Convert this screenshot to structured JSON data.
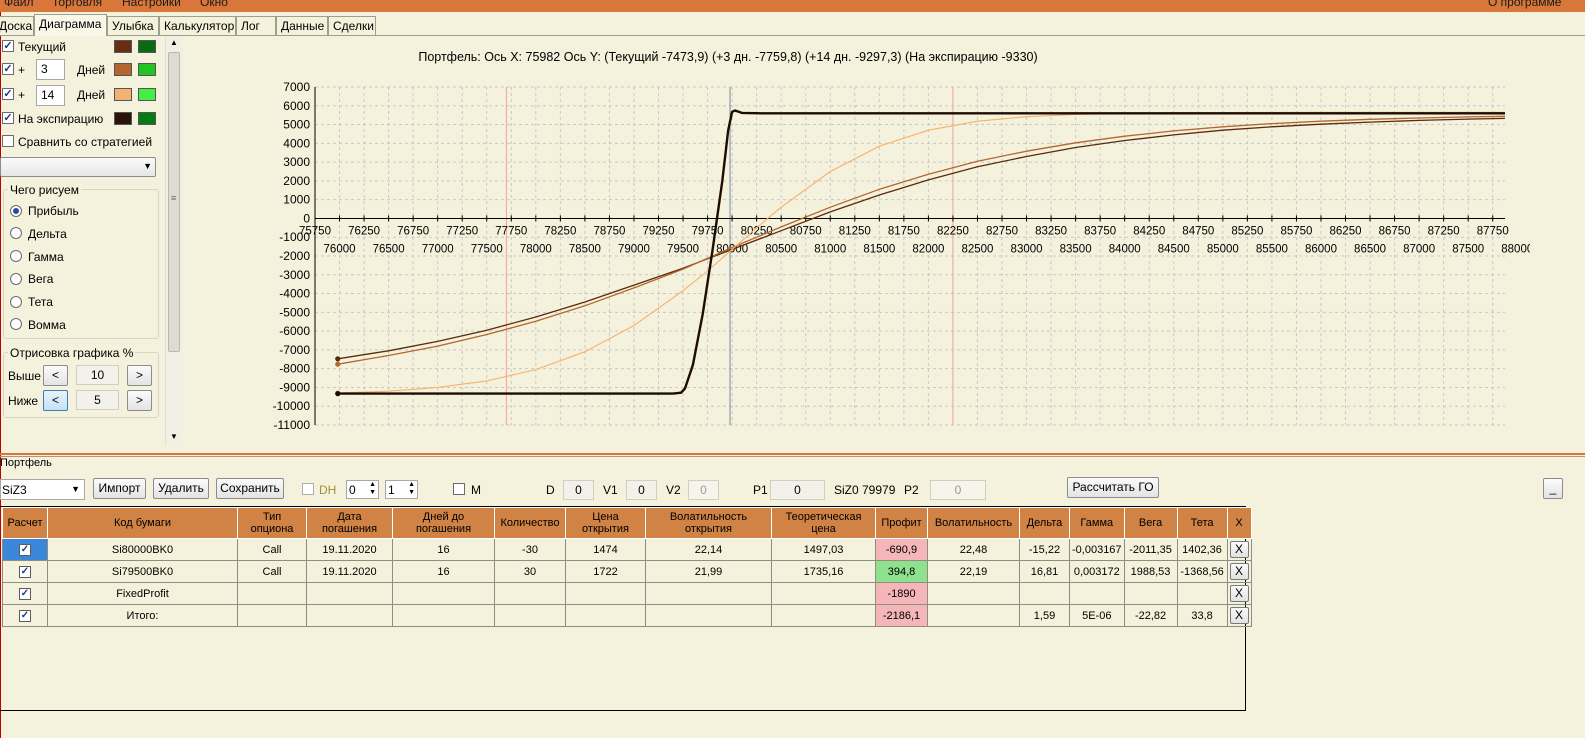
{
  "menu": {
    "items": [
      "Файл",
      "Торговля",
      "Настройки",
      "Окно"
    ],
    "about": "О программе"
  },
  "tabs": [
    "Доска",
    "Диаграмма",
    "Улыбка",
    "Калькулятор",
    "Лог",
    "Данные",
    "Сделки"
  ],
  "left_panel": {
    "current_label": "Текущий",
    "plus": "+",
    "days_label": "Дней",
    "days_1": "3",
    "days_2": "14",
    "expiry_label": "На экспирацию",
    "compare_label": "Сравнить со стратегией",
    "draw_group": "Чего рисуем",
    "options": [
      "Прибыль",
      "Дельта",
      "Гамма",
      "Вега",
      "Тета",
      "Вомма"
    ],
    "render_group": "Отрисовка графика %",
    "above_label": "Выше",
    "below_label": "Ниже",
    "above_value": "10",
    "below_value": "5",
    "prev": "<",
    "next": ">",
    "colors": {
      "current": [
        "#6b2d12",
        "#0b6b12"
      ],
      "d3": [
        "#b5652e",
        "#22c422"
      ],
      "d14": [
        "#f3b273",
        "#44ee44"
      ],
      "expiry": [
        "#2a1407",
        "#077a12"
      ]
    }
  },
  "chart_data": {
    "type": "line",
    "title": "Портфель: Ось X: 75982 Ось Y:  (Текущий -7473,9)  (+3 дн. -7759,8)  (+14 дн. -9297,3)  (На экспирацию -9330)",
    "xlim": [
      75750,
      87875
    ],
    "ylim": [
      -11000,
      7000
    ],
    "x_ticks_top": [
      75750,
      76250,
      76750,
      77250,
      77750,
      78250,
      78750,
      79250,
      79750,
      80250,
      80750,
      81250,
      81750,
      82250,
      82750,
      83250,
      83750,
      84250,
      84750,
      85250,
      85750,
      86250,
      86750,
      87250,
      87750
    ],
    "x_ticks_bottom": [
      76000,
      76500,
      77000,
      77500,
      78000,
      78500,
      79000,
      79500,
      80000,
      80500,
      81000,
      81500,
      82000,
      82500,
      83000,
      83500,
      84000,
      84500,
      85000,
      85500,
      86000,
      86500,
      87000,
      87500,
      88000
    ],
    "y_ticks": [
      7000,
      6000,
      5000,
      4000,
      3000,
      2000,
      1000,
      0,
      -1000,
      -2000,
      -3000,
      -4000,
      -5000,
      -6000,
      -7000,
      -8000,
      -9000,
      -10000,
      -11000
    ],
    "grid": true,
    "vlines": [
      {
        "x": 77700,
        "color": "#f2a0a0"
      },
      {
        "x": 79979,
        "color": "#7a8ca8"
      },
      {
        "x": 82250,
        "color": "#f2a0a0"
      }
    ],
    "series": [
      {
        "name": "Текущий",
        "color": "#5a2a0c",
        "width": 1.3,
        "x": [
          75982,
          76500,
          77000,
          77500,
          78000,
          78500,
          79000,
          79500,
          80000,
          80500,
          81000,
          81500,
          82000,
          82500,
          83000,
          83500,
          84000,
          84500,
          85000,
          85500,
          86000,
          86500,
          87000,
          87500,
          87875
        ],
        "y": [
          -7474,
          -7050,
          -6550,
          -5950,
          -5250,
          -4450,
          -3550,
          -2650,
          -1650,
          -650,
          350,
          1250,
          2050,
          2750,
          3300,
          3780,
          4150,
          4450,
          4700,
          4880,
          5020,
          5130,
          5220,
          5290,
          5330
        ]
      },
      {
        "name": "+3 дн.",
        "color": "#b5652e",
        "width": 1.3,
        "x": [
          75982,
          76500,
          77000,
          77500,
          78000,
          78500,
          79000,
          79500,
          80000,
          80500,
          81000,
          81500,
          82000,
          82500,
          83000,
          83500,
          84000,
          84500,
          85000,
          85500,
          86000,
          86500,
          87000,
          87500,
          87875
        ],
        "y": [
          -7760,
          -7300,
          -6800,
          -6180,
          -5480,
          -4650,
          -3700,
          -2700,
          -1550,
          -450,
          600,
          1550,
          2350,
          3050,
          3580,
          4030,
          4380,
          4660,
          4880,
          5050,
          5180,
          5280,
          5350,
          5410,
          5440
        ]
      },
      {
        "name": "+14 дн.",
        "color": "#f7b069",
        "width": 1.1,
        "x": [
          75982,
          76500,
          77000,
          77500,
          78000,
          78500,
          79000,
          79500,
          79750,
          80000,
          80250,
          80500,
          81000,
          81500,
          82000,
          82500,
          83000,
          83500,
          84000,
          84500,
          85000,
          86000,
          87000,
          87875
        ],
        "y": [
          -9297,
          -9200,
          -9000,
          -8650,
          -8050,
          -7100,
          -5700,
          -3850,
          -2800,
          -1650,
          -500,
          600,
          2500,
          3850,
          4700,
          5180,
          5420,
          5540,
          5600,
          5625,
          5640,
          5650,
          5650,
          5650
        ]
      },
      {
        "name": "На экспирацию",
        "color": "#1e0c02",
        "width": 2.4,
        "x": [
          75982,
          76500,
          77000,
          77500,
          78000,
          78500,
          79000,
          79400,
          79480,
          79520,
          79600,
          79700,
          79800,
          79900,
          79960,
          80000,
          80030,
          80100,
          80300,
          81000,
          82000,
          84000,
          86000,
          87875
        ],
        "y": [
          -9330,
          -9330,
          -9330,
          -9330,
          -9330,
          -9330,
          -9330,
          -9330,
          -9280,
          -9050,
          -7800,
          -5100,
          -1700,
          2000,
          4700,
          5680,
          5750,
          5620,
          5600,
          5600,
          5600,
          5600,
          5600,
          5600
        ]
      }
    ]
  },
  "portfolio": {
    "section_label": "Портфель",
    "instrument": "SiZ3",
    "import_btn": "Импорт",
    "delete_btn": "Удалить",
    "save_btn": "Сохранить",
    "dh_label": "DH",
    "spin1": "0",
    "spin2": "1",
    "m_label": "M",
    "d_label": "D",
    "d_value": "0",
    "v1_label": "V1",
    "v1_value": "0",
    "v2_label": "V2",
    "v2_value": "0",
    "p1_label": "P1",
    "p1_value": "0",
    "futures_text": "SiZ0 79979",
    "p2_label": "P2",
    "p2_value": "0",
    "calc_btn": "Рассчитать ГО",
    "min_btn": "_"
  },
  "table": {
    "headers": [
      "Расчет",
      "Код бумаги",
      "Тип опциона",
      "Дата погашения",
      "Дней до погашения",
      "Количество",
      "Цена открытия",
      "Волатильность открытия",
      "Теоретическая цена",
      "Профит",
      "Волатильность",
      "Дельта",
      "Гамма",
      "Вега",
      "Тета",
      "X"
    ],
    "rows": [
      [
        "✓",
        "Si80000BK0",
        "Call",
        "19.11.2020",
        "16",
        "-30",
        "1474",
        "22,14",
        "1497,03",
        "-690,9",
        "22,48",
        "-15,22",
        "-0,003167",
        "-2011,35",
        "1402,36",
        "X"
      ],
      [
        "✓",
        "Si79500BK0",
        "Call",
        "19.11.2020",
        "16",
        "30",
        "1722",
        "21,99",
        "1735,16",
        "394,8",
        "22,19",
        "16,81",
        "0,003172",
        "1988,53",
        "-1368,56",
        "X"
      ],
      [
        "✓",
        "FixedProfit",
        "",
        "",
        "",
        "",
        "",
        "",
        "",
        "-1890",
        "",
        "",
        "",
        "",
        "",
        "X"
      ],
      [
        "✓",
        "Итого:",
        "",
        "",
        "",
        "",
        "",
        "",
        "",
        "-2186,1",
        "",
        "1,59",
        "5E-06",
        "-22,82",
        "33,8",
        "X"
      ]
    ],
    "profit_colors": [
      "red",
      "green",
      "red",
      "red"
    ]
  }
}
